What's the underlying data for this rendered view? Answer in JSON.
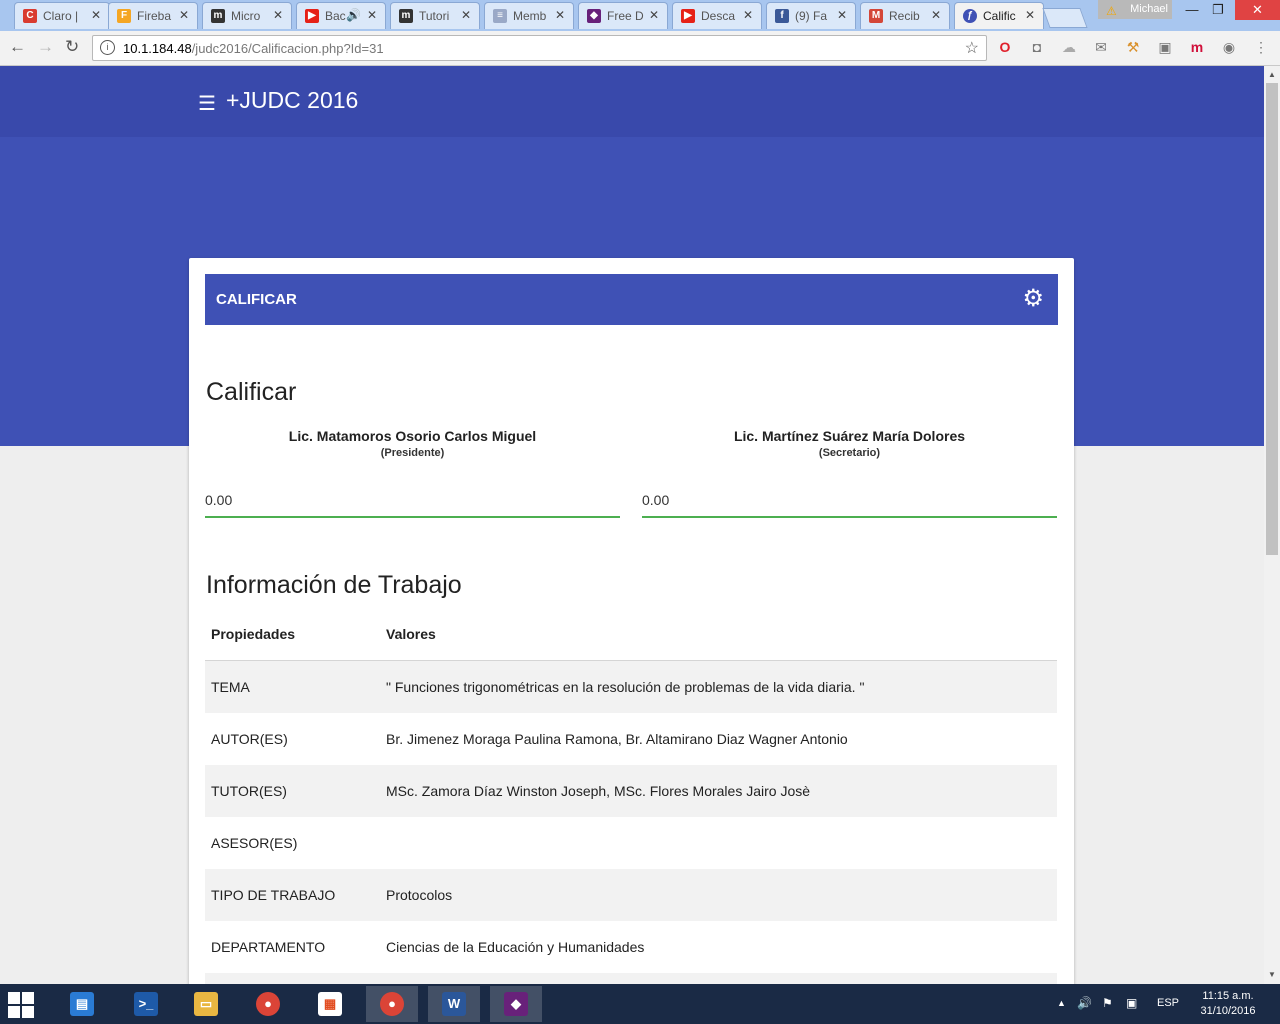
{
  "browser": {
    "tabs": [
      {
        "label": "Claro |",
        "favicon_color": "#d93b30",
        "favicon_glyph": "C"
      },
      {
        "label": "Fireba",
        "favicon_color": "#f5a623",
        "favicon_glyph": "F"
      },
      {
        "label": "Micro",
        "favicon_color": "#333333",
        "favicon_glyph": "m"
      },
      {
        "label": "Bac",
        "favicon_color": "#e62117",
        "favicon_glyph": "▶"
      },
      {
        "label": "Tutori",
        "favicon_color": "#333333",
        "favicon_glyph": "m"
      },
      {
        "label": "Memb",
        "favicon_color": "#9aa9c7",
        "favicon_glyph": "≡"
      },
      {
        "label": "Free D",
        "favicon_color": "#68217a",
        "favicon_glyph": "◆"
      },
      {
        "label": "Desca",
        "favicon_color": "#e62117",
        "favicon_glyph": "▶"
      },
      {
        "label": "(9) Fa",
        "favicon_color": "#3b5998",
        "favicon_glyph": "f"
      },
      {
        "label": "Recib",
        "favicon_color": "#d44638",
        "favicon_glyph": "M"
      },
      {
        "label": "Calific",
        "favicon_color": "#3f51b5",
        "favicon_glyph": "ƒ"
      }
    ],
    "active_tab_index": 10,
    "profile_name": "Michael",
    "url_host": "10.1.184.48",
    "url_path": "/judc2016/Calificacion.php?Id=31"
  },
  "app": {
    "title": "+JUDC 2016",
    "card_title": "CALIFICAR",
    "section_title": "Calificar",
    "judges": [
      {
        "name": "Lic. Matamoros Osorio Carlos Miguel",
        "role": "(Presidente)",
        "grade": "0.00"
      },
      {
        "name": "Lic. Martínez Suárez María Dolores",
        "role": "(Secretario)",
        "grade": "0.00"
      }
    ],
    "info_title": "Información de Trabajo",
    "table_headers": {
      "key": "Propiedades",
      "value": "Valores"
    },
    "rows": [
      {
        "key": "TEMA",
        "value": "\" Funciones trigonométricas en la resolución de problemas de la vida diaria. \""
      },
      {
        "key": "AUTOR(ES)",
        "value": "Br. Jimenez Moraga Paulina Ramona, Br. Altamirano Diaz Wagner Antonio"
      },
      {
        "key": "TUTOR(ES)",
        "value": "MSc. Zamora Díaz Winston Joseph, MSc. Flores Morales Jairo Josè"
      },
      {
        "key": "ASESOR(ES)",
        "value": ""
      },
      {
        "key": "TIPO DE TRABAJO",
        "value": "Protocolos"
      },
      {
        "key": "DEPARTAMENTO",
        "value": "Ciencias de la Educación y Humanidades"
      }
    ],
    "colors": {
      "primary": "#3f51b5",
      "appbar": "#3949ab",
      "input_underline": "#4caf50"
    }
  },
  "taskbar": {
    "language": "ESP",
    "time": "11:15 a.m.",
    "date": "31/10/2016"
  }
}
